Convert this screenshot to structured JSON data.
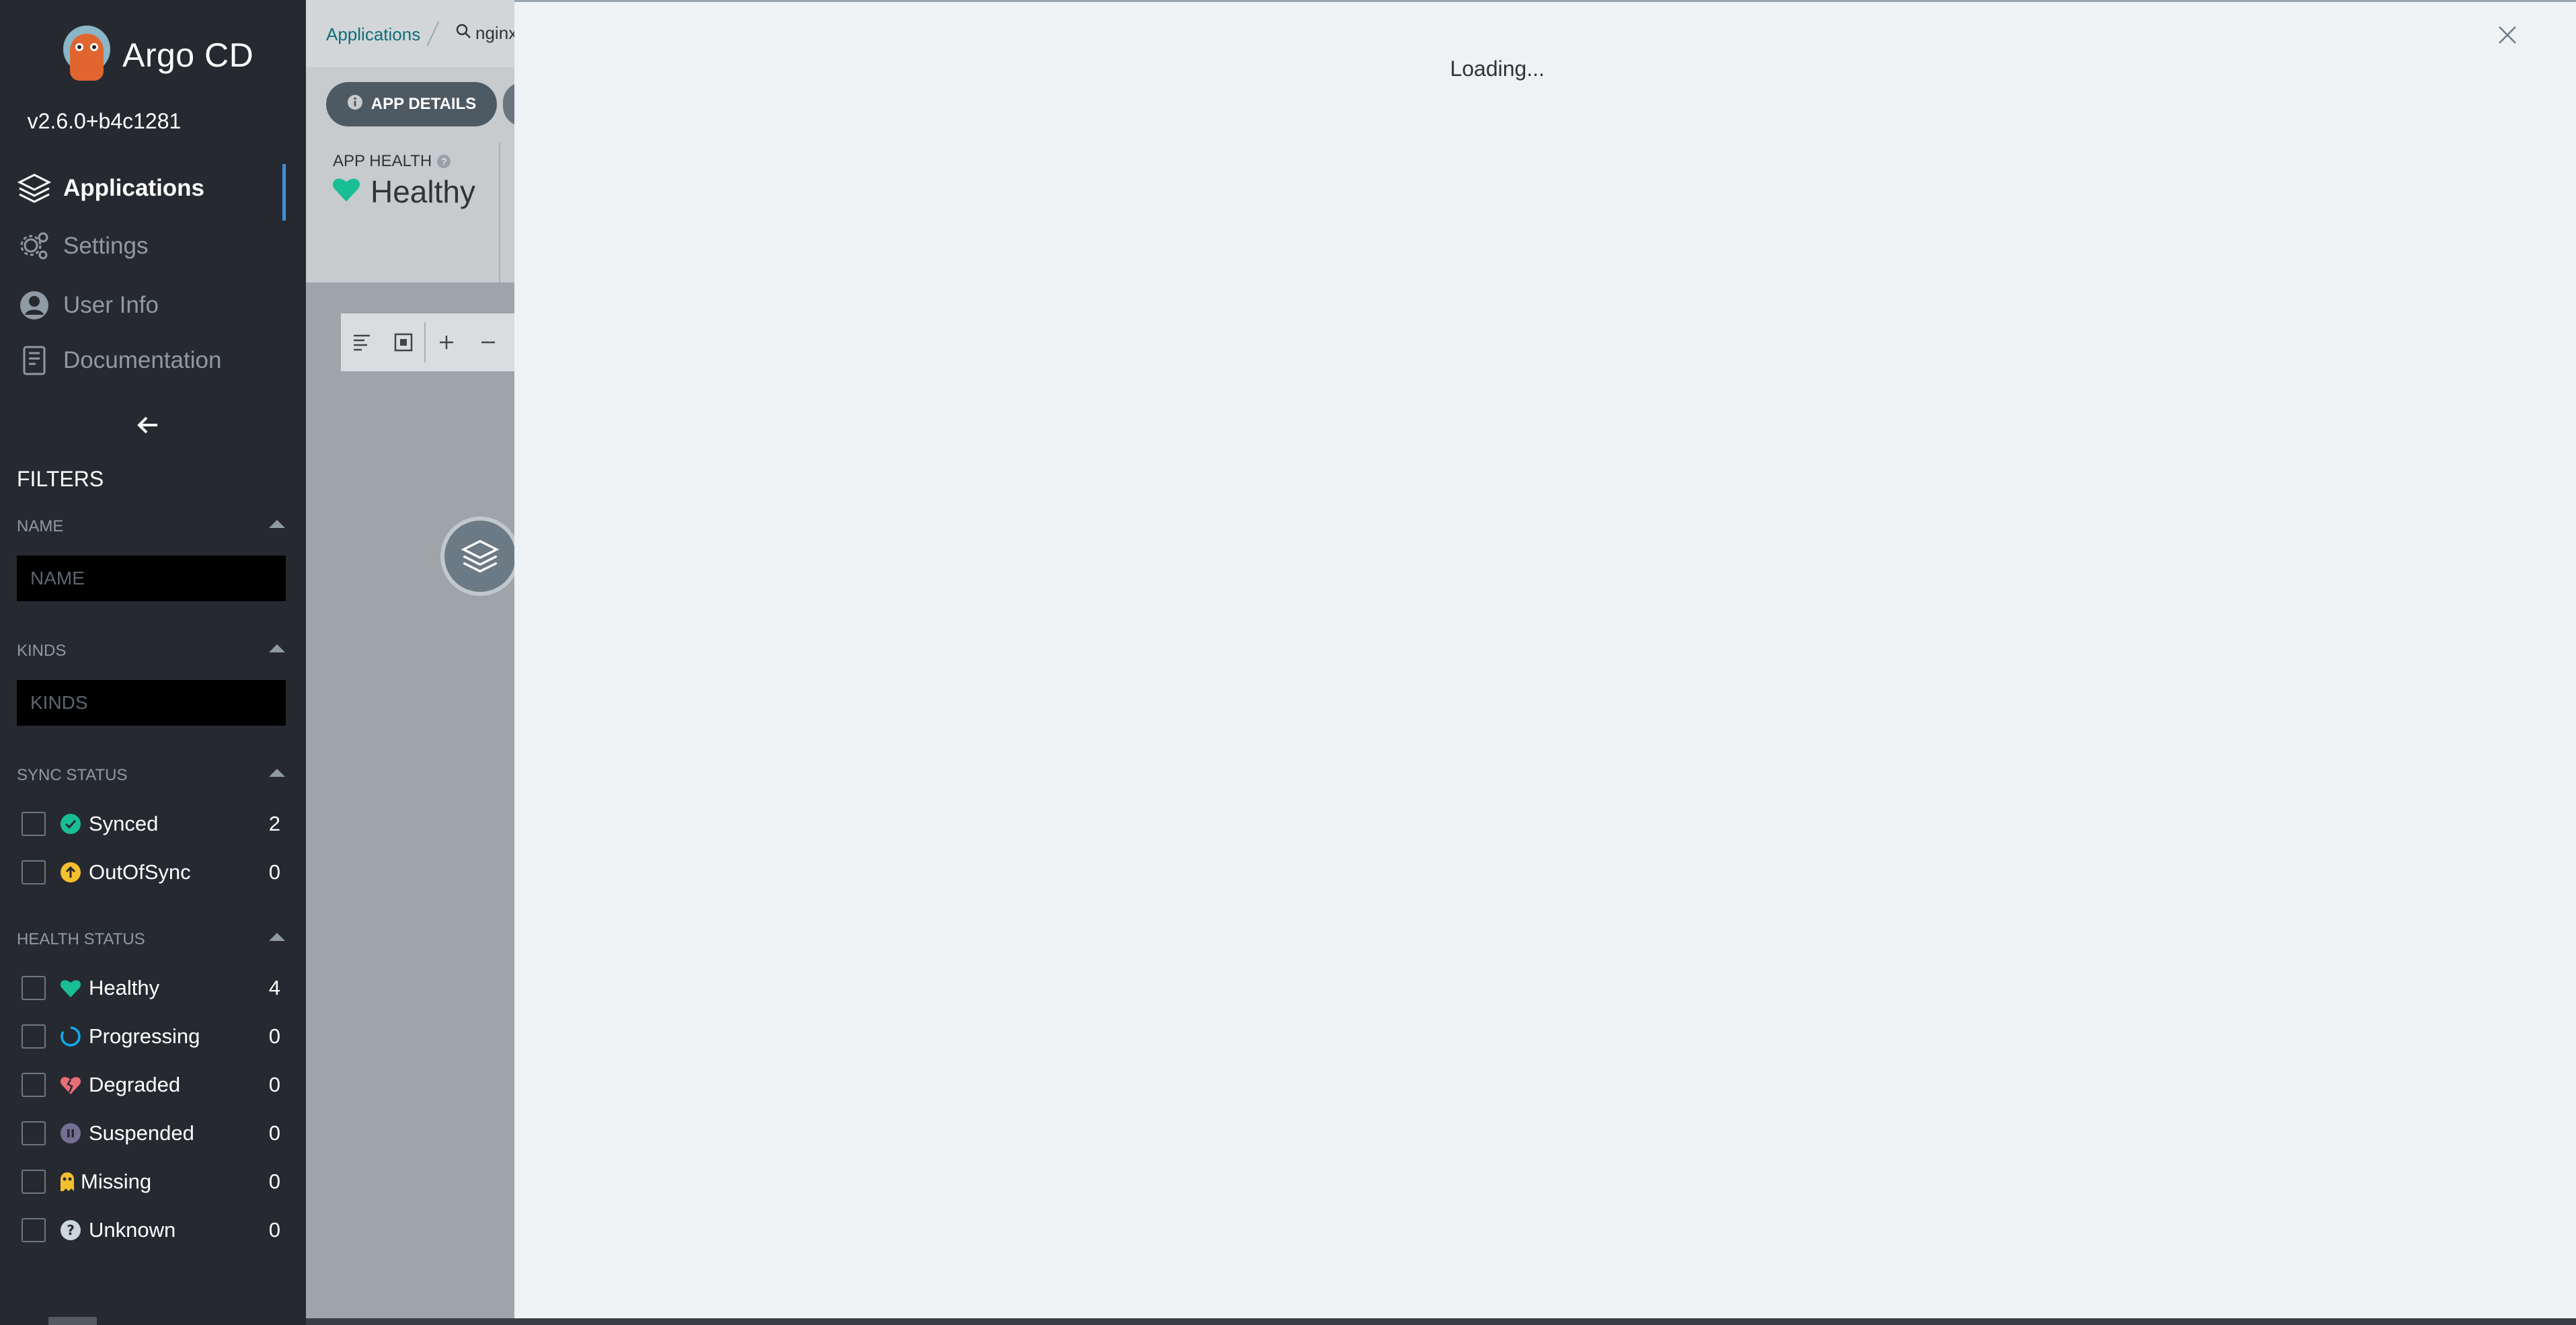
{
  "app": {
    "name": "Argo CD",
    "version": "v2.6.0+b4c1281"
  },
  "nav": [
    {
      "label": "Applications",
      "icon": "layers-icon",
      "active": true
    },
    {
      "label": "Settings",
      "icon": "gear-icon"
    },
    {
      "label": "User Info",
      "icon": "user-icon"
    },
    {
      "label": "Documentation",
      "icon": "book-icon"
    }
  ],
  "filters": {
    "title": "FILTERS",
    "name": {
      "label": "NAME",
      "placeholder": "NAME"
    },
    "kinds": {
      "label": "KINDS",
      "placeholder": "KINDS"
    },
    "sync": {
      "label": "SYNC STATUS",
      "items": [
        {
          "label": "Synced",
          "count": "2",
          "icon": "check-circle-icon",
          "color": "#18be94"
        },
        {
          "label": "OutOfSync",
          "count": "0",
          "icon": "arrow-up-circle-icon",
          "color": "#f4c030"
        }
      ]
    },
    "health": {
      "label": "HEALTH STATUS",
      "items": [
        {
          "label": "Healthy",
          "count": "4",
          "icon": "heart-icon",
          "color": "#18be94"
        },
        {
          "label": "Progressing",
          "count": "0",
          "icon": "circle-notch-icon",
          "color": "#0dadea"
        },
        {
          "label": "Degraded",
          "count": "0",
          "icon": "heart-broken-icon",
          "color": "#e96d76"
        },
        {
          "label": "Suspended",
          "count": "0",
          "icon": "pause-circle-icon",
          "color": "#766f94"
        },
        {
          "label": "Missing",
          "count": "0",
          "icon": "ghost-icon",
          "color": "#f4c030"
        },
        {
          "label": "Unknown",
          "count": "0",
          "icon": "question-circle-icon",
          "color": "#ccd6dd"
        }
      ]
    }
  },
  "breadcrumb": {
    "root": "Applications",
    "search": "nginx"
  },
  "toolbar": {
    "app_details_label": "APP DETAILS"
  },
  "app_health": {
    "label": "APP HEALTH",
    "value": "Healthy"
  },
  "panel": {
    "status": "Loading..."
  },
  "colors": {
    "sidebar_bg": "#262a30",
    "accent": "#3e8fde",
    "healthy": "#18be94"
  }
}
